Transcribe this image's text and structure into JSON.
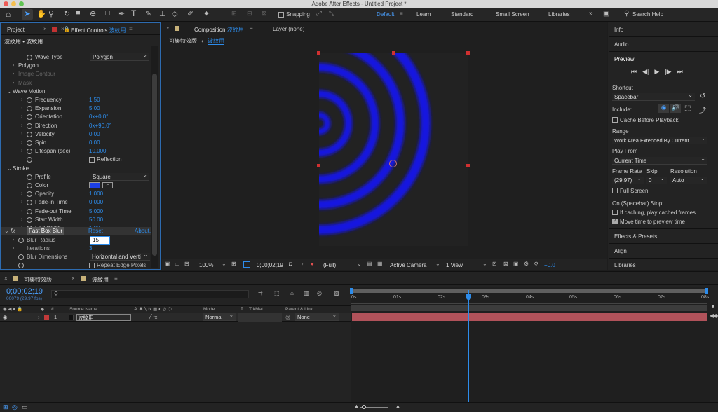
{
  "window": {
    "title": "Adobe After Effects - Untitled Project *"
  },
  "toolbar": {
    "snapping": "Snapping",
    "workspaces": [
      "Default",
      "Learn",
      "Standard",
      "Small Screen",
      "Libraries"
    ],
    "search_placeholder": "Search Help"
  },
  "left_panel": {
    "tab_project": "Project",
    "tab_effect_controls": "Effect Controls",
    "tab_effect_layer": "波紋用",
    "breadcrumb_comp": "波紋用",
    "breadcrumb_sep": "•",
    "breadcrumb_layer": "波紋用",
    "rows": [
      {
        "label": "Wave Type",
        "value": "Polygon",
        "kind": "dropdown"
      },
      {
        "label": "Polygon",
        "kind": "group"
      },
      {
        "label": "Image Contour",
        "kind": "group",
        "disabled": true
      },
      {
        "label": "Mask",
        "kind": "group",
        "disabled": true
      },
      {
        "label": "Wave Motion",
        "kind": "section"
      },
      {
        "label": "Frequency",
        "value": "1.50"
      },
      {
        "label": "Expansion",
        "value": "5.00"
      },
      {
        "label": "Orientation",
        "value": "0x+0.0°"
      },
      {
        "label": "Direction",
        "value": "0x+90.0°"
      },
      {
        "label": "Velocity",
        "value": "0.00"
      },
      {
        "label": "Spin",
        "value": "0.00"
      },
      {
        "label": "Lifespan (sec)",
        "value": "10.000"
      },
      {
        "label": "",
        "value": "Reflection",
        "kind": "checkbox"
      },
      {
        "label": "Stroke",
        "kind": "section"
      },
      {
        "label": "Profile",
        "value": "Square",
        "kind": "dropdown"
      },
      {
        "label": "Color",
        "kind": "color"
      },
      {
        "label": "Opacity",
        "value": "1.000"
      },
      {
        "label": "Fade-in Time",
        "value": "0.000"
      },
      {
        "label": "Fade-out Time",
        "value": "5.000"
      },
      {
        "label": "Start Width",
        "value": "50.00"
      },
      {
        "label": "End Width",
        "value": "1.00"
      }
    ],
    "fx_name": "Fast Box Blur",
    "fx_reset": "Reset",
    "fx_about": "About.",
    "blur_radius_label": "Blur Radius",
    "blur_radius_value": "15",
    "iterations_label": "Iterations",
    "iterations_value": "3",
    "blur_dim_label": "Blur Dimensions",
    "blur_dim_value": "Horizontal and Verti",
    "repeat_edge": "Repeat Edge Pixels",
    "fx_symbol": "fx"
  },
  "composition": {
    "tab_label": "Composition",
    "tab_name": "波紋用",
    "layer_tab": "Layer (none)",
    "crumb1": "可樂特效版",
    "crumb2": "波紋用",
    "zoom": "100%",
    "timecode": "0;00;02;19",
    "resolution": "(Full)",
    "camera": "Active Camera",
    "view": "1 View",
    "exposure": "+0.0"
  },
  "right_panel": {
    "info": "Info",
    "audio": "Audio",
    "preview": "Preview",
    "shortcut_label": "Shortcut",
    "shortcut_value": "Spacebar",
    "include_label": "Include:",
    "cache_before": "Cache Before Playback",
    "range_label": "Range",
    "range_value": "Work Area Extended By Current ...",
    "play_from_label": "Play From",
    "play_from_value": "Current Time",
    "frame_rate_label": "Frame Rate",
    "skip_label": "Skip",
    "resolution_label": "Resolution",
    "frame_rate_value": "(29.97)",
    "skip_value": "0",
    "resolution_value": "Auto",
    "full_screen": "Full Screen",
    "stop_label": "On (Spacebar) Stop:",
    "if_caching": "If caching, play cached frames",
    "move_time": "Move time to preview time",
    "effects_presets": "Effects & Presets",
    "align": "Align",
    "libraries": "Libraries"
  },
  "timeline": {
    "tab_comp1": "可樂特效版",
    "tab_comp2": "波紋用",
    "timecode": "0;00;02;19",
    "frame_info": "00079 (29.97 fps)",
    "col_source": "Source Name",
    "col_mode": "Mode",
    "col_t": "T",
    "col_trkmat": "TrkMat",
    "col_parent": "Parent & Link",
    "layer": {
      "num": "1",
      "name": "波紋用",
      "mode": "Normal",
      "parent": "None"
    },
    "ruler": [
      "0s",
      "01s",
      "02s",
      "03s",
      "04s",
      "05s",
      "06s",
      "07s",
      "08s"
    ]
  },
  "colors": {
    "accent": "#2d8ceb",
    "wave": "#1414e0",
    "layer_bar": "#b1525a"
  }
}
